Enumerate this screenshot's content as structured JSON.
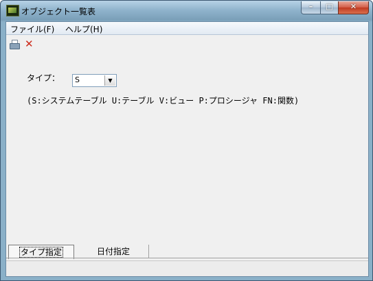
{
  "window": {
    "title": "オブジェクト一覧表",
    "min_glyph": "–",
    "max_glyph": "□",
    "close_glyph": "✕"
  },
  "menubar": {
    "items": [
      {
        "label": "ファイル(F)"
      },
      {
        "label": "ヘルプ(H)"
      }
    ]
  },
  "toolbar": {
    "icons": [
      "printer-icon",
      "close-icon"
    ],
    "close_glyph": "✕"
  },
  "form": {
    "type_label": "タイプ：",
    "type_select_value": "S",
    "description": "(S:システムテーブル U:テーブル V:ビュー P:プロシージャ FN:関数)"
  },
  "tabs": [
    {
      "label": "タイプ指定",
      "active": true
    },
    {
      "label": "日付指定",
      "active": false
    }
  ],
  "status": {
    "text": ""
  }
}
